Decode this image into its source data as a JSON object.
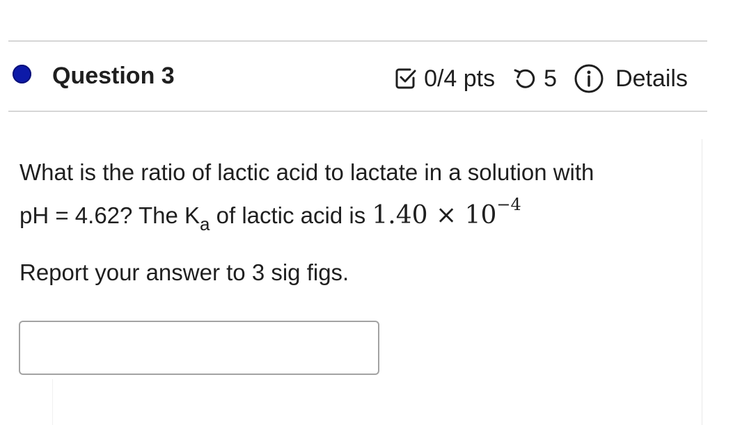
{
  "question": {
    "title": "Question 3",
    "status_color": "#0d1aa8",
    "score": "0/4 pts",
    "attempts": "5",
    "details_label": "Details",
    "icons": {
      "score": "checkbox-check-icon",
      "attempts": "retry-arrow-icon",
      "details": "info-circle-icon"
    }
  },
  "body": {
    "line1": "What is the ratio of lactic acid to lactate in a solution with",
    "line2_prefix": "pH = 4.62? The K",
    "ka_subscript": "a",
    "line2_mid": " of lactic acid is ",
    "ka_mantissa": "1.40",
    "ka_times": " × ",
    "ka_base": "10",
    "ka_exponent": "−4",
    "instruction": "Report your answer to 3 sig figs."
  },
  "answer": {
    "value": "",
    "placeholder": ""
  }
}
